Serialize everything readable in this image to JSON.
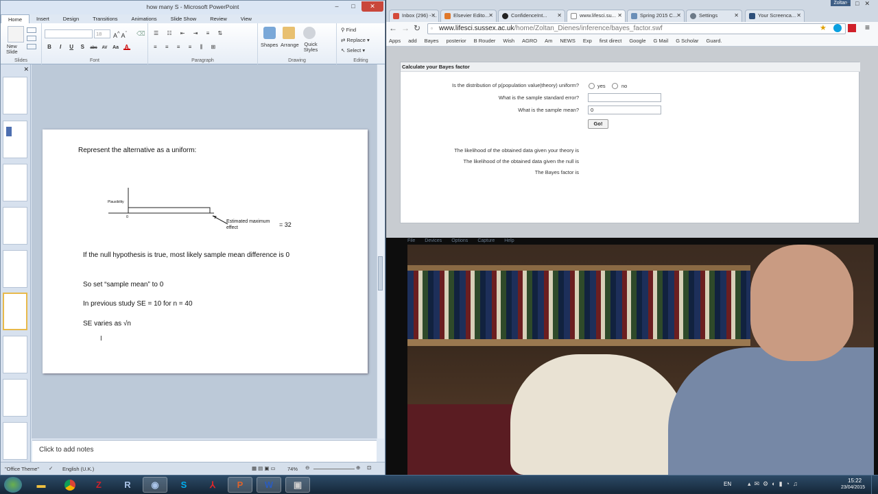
{
  "powerpoint": {
    "title": "how many S - Microsoft PowerPoint",
    "ribbon_tabs": [
      "Home",
      "Insert",
      "Design",
      "Transitions",
      "Animations",
      "Slide Show",
      "Review",
      "View"
    ],
    "font_size": "18",
    "groups": {
      "slides": "Slides",
      "font": "Font",
      "paragraph": "Paragraph",
      "drawing": "Drawing",
      "editing": "Editing"
    },
    "new_slide_label": "New\nSlide",
    "drawing_items": [
      "Shapes",
      "Arrange",
      "Quick Styles"
    ],
    "editing_items": [
      "Find",
      "Replace",
      "Select"
    ],
    "font_buttons": [
      "B",
      "I",
      "U",
      "S",
      "abc",
      "AV",
      "Aa",
      "A"
    ],
    "slide": {
      "line1": "Represent the alternative as a uniform:",
      "plausibility_label": "Plausibility",
      "zero_label": "0",
      "estimated_label": "Estimated maximum effect",
      "equals_32": "= 32",
      "line2": "If the null hypothesis is true, most likely sample mean difference is 0",
      "line3": "So set “sample mean”  to 0",
      "line4": "In previous study SE = 10 for n = 40",
      "line5": "SE varies as √n"
    },
    "notes_placeholder": "Click to add notes",
    "status": {
      "theme": "\"Office Theme\"",
      "language": "English (U.K.)",
      "zoom": "74%"
    }
  },
  "chrome": {
    "user": "Zoltan",
    "tabs": [
      {
        "label": "Inbox (296) - ...",
        "color": "#d44a3a"
      },
      {
        "label": "Elsevier Edito...",
        "color": "#e0782a"
      },
      {
        "label": "ConfidenceInt...",
        "color": "#222222"
      },
      {
        "label": "www.lifesci.su...",
        "color": "#4a6a9a",
        "active": true
      },
      {
        "label": "Spring 2015 C...",
        "color": "#6b8fb8"
      },
      {
        "label": "Settings",
        "color": "#6d7a88"
      },
      {
        "label": "Your Screenca...",
        "color": "#2d4f7a"
      }
    ],
    "url_host": "www.lifesci.sussex.ac.uk",
    "url_path": "/home/Zoltan_Dienes/inference/bayes_factor.swf",
    "bookmarks": [
      "Apps",
      "add",
      "Bayes",
      "posterior",
      "B Rouder",
      "Wish",
      "AGRO",
      "Am",
      "NEWS",
      "Exp",
      "first direct",
      "Google",
      "G Mail",
      "G Scholar",
      "Guard."
    ],
    "calc": {
      "title": "Calculate your Bayes factor",
      "q_uniform": "Is the distribution of p(population value|theory) uniform?",
      "yes": "yes",
      "no": "no",
      "q_se": "What is the sample standard error?",
      "q_mean": "What is the sample mean?",
      "mean_value": "0",
      "go": "Go!",
      "r_theory": "The likelihood of the obtained data given your theory is",
      "r_null": "The likelihood of the obtained data given the null is",
      "r_bf": "The Bayes factor is"
    }
  },
  "webcam": {
    "menu": [
      "File",
      "Devices",
      "Options",
      "Capture",
      "Help"
    ]
  },
  "taskbar": {
    "apps": [
      "Explorer",
      "Chrome",
      "FileZilla",
      "R",
      "R Console",
      "Skype",
      "Acrobat",
      "PowerPoint",
      "Word",
      "Screen"
    ],
    "lang": "EN",
    "time": "15:22",
    "date": "23/04/2015"
  }
}
